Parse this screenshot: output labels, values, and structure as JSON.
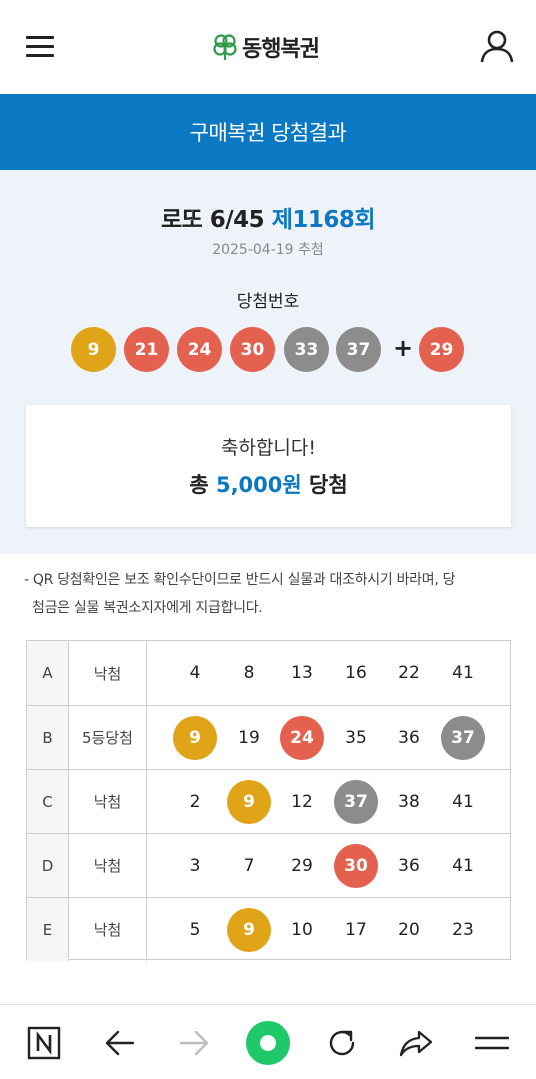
{
  "header": {
    "brand": "동행복권",
    "menu_icon": "hamburger-menu-icon",
    "user_icon": "user-icon"
  },
  "page_title": "구매복권 당첨결과",
  "draw": {
    "game": "로또 6/45",
    "round": "제1168회",
    "date": "2025-04-19 추첨",
    "winning_label": "당첨번호",
    "numbers": [
      9,
      21,
      24,
      30,
      33,
      37
    ],
    "bonus": 29,
    "plus_sign": "+"
  },
  "prize": {
    "congrats": "축하합니다!",
    "prefix": "총",
    "amount": "5,000원",
    "suffix": "당첨"
  },
  "notice": {
    "line1": "- QR 당첨확인은 보조 확인수단이므로 반드시 실물과 대조하시기 바라며, 당",
    "line2": "첨금은 실물 복권소지자에게 지급합니다."
  },
  "tickets": [
    {
      "slot": "A",
      "result": "낙첨",
      "numbers": [
        "4",
        "8",
        "13",
        "16",
        "22",
        "41"
      ],
      "hits": [
        false,
        false,
        false,
        false,
        false,
        false
      ]
    },
    {
      "slot": "B",
      "result": "5등당첨",
      "numbers": [
        "9",
        "19",
        "24",
        "35",
        "36",
        "37"
      ],
      "hits": [
        true,
        false,
        true,
        false,
        false,
        true
      ]
    },
    {
      "slot": "C",
      "result": "낙첨",
      "numbers": [
        "2",
        "9",
        "12",
        "37",
        "38",
        "41"
      ],
      "hits": [
        false,
        true,
        false,
        true,
        false,
        false
      ]
    },
    {
      "slot": "D",
      "result": "낙첨",
      "numbers": [
        "3",
        "7",
        "29",
        "30",
        "36",
        "41"
      ],
      "hits": [
        false,
        false,
        false,
        true,
        false,
        false
      ]
    },
    {
      "slot": "E",
      "result": "낙첨",
      "numbers": [
        "5",
        "9",
        "10",
        "17",
        "20",
        "23"
      ],
      "hits": [
        false,
        true,
        false,
        false,
        false,
        false
      ]
    }
  ],
  "colors": {
    "accent": "#0a78c2",
    "ball_yellow": "#e0a418",
    "ball_red": "#e4604f",
    "ball_gray": "#8c8c8c",
    "logo_green": "#2e9a48"
  },
  "bottom_nav": [
    "naver-n-icon",
    "back-arrow-icon",
    "forward-arrow-icon",
    "home-circle-icon",
    "refresh-icon",
    "share-icon",
    "more-menu-icon"
  ]
}
